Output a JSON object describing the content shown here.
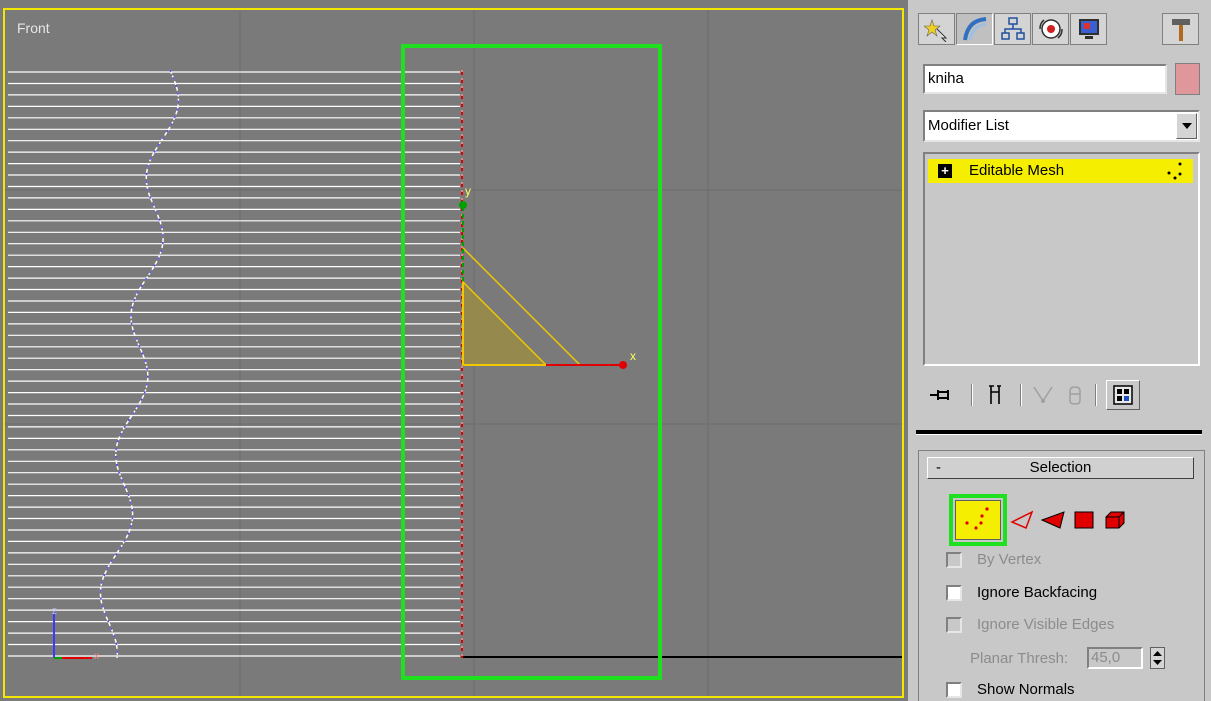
{
  "viewport": {
    "label": "Front",
    "axis_x": "x",
    "axis_y": "y",
    "axis_z": "z",
    "gizmo_x_label": "x",
    "gizmo_y_label": "y"
  },
  "command_panel": {
    "tabs": [
      {
        "name": "create-tab",
        "icon": "create-icon"
      },
      {
        "name": "modify-tab",
        "icon": "modify-icon"
      },
      {
        "name": "hierarchy-tab",
        "icon": "hierarchy-icon"
      },
      {
        "name": "motion-tab",
        "icon": "motion-icon"
      },
      {
        "name": "display-tab",
        "icon": "display-icon"
      },
      {
        "name": "utilities-tab",
        "icon": "hammer-icon"
      }
    ],
    "object_name": "kniha",
    "object_color": "#e0979c",
    "modifier_list_label": "Modifier List",
    "stack_items": [
      {
        "label": "Editable Mesh",
        "expander": "+"
      }
    ],
    "stack_tools": [
      "pin-stack-icon",
      "show-end-result-icon",
      "make-unique-icon",
      "remove-modifier-icon",
      "configure-modifier-sets-icon"
    ]
  },
  "selection_rollout": {
    "collapse_symbol": "-",
    "title": "Selection",
    "sub_object_levels": [
      "vertex",
      "edge",
      "face",
      "polygon",
      "element"
    ],
    "active_level": "vertex",
    "by_vertex_label": "By Vertex",
    "ignore_backfacing_label": "Ignore Backfacing",
    "ignore_visible_edges_label": "Ignore Visible Edges",
    "planar_thresh_label": "Planar Thresh:",
    "planar_thresh_value": "45,0",
    "show_normals_label": "Show Normals"
  },
  "colors": {
    "viewport_bg": "#7a7a7a",
    "active_frame": "#f3e600",
    "highlight_green": "#1fe01f",
    "selection_yellow": "#f5ee00"
  }
}
